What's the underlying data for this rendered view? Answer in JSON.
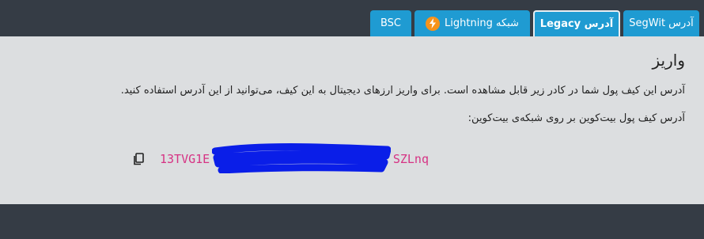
{
  "tabs": [
    {
      "label": "آدرس SegWit",
      "active": false
    },
    {
      "label": "آدرس Legacy",
      "active": true
    },
    {
      "label": "شبکه Lightning",
      "active": false
    },
    {
      "label": "BSC",
      "active": false
    }
  ],
  "deposit": {
    "title": "واریز",
    "description": "آدرس این کیف پول شما در کادر زیر قابل مشاهده است. برای واریز ارزهای دیجیتال به این کیف، می‌توانید از این آدرس استفاده کنید.",
    "address_label": "آدرس کیف پول بیت‌کوین بر روی شبکه‌ی بیت‌کوین:",
    "address_start": "13TVG1E",
    "address_end": "SZLnq"
  },
  "colors": {
    "tab_bg": "#1f9bd2",
    "lightning_icon": "#f7931a",
    "address_text": "#d63384",
    "redaction_scribble": "#0a1ee8"
  },
  "icons": {
    "lightning": "lightning-bolt-icon",
    "copy": "copy-icon"
  }
}
